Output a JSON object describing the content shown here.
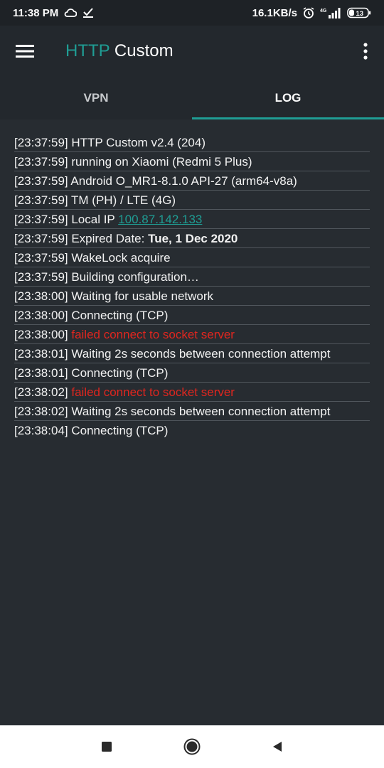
{
  "status_bar": {
    "time": "11:38 PM",
    "net_speed": "16.1KB/s",
    "battery": "13",
    "icons": [
      "cloud-icon",
      "download-check-icon",
      "alarm-icon",
      "signal-4g-icon",
      "battery-icon"
    ]
  },
  "app_bar": {
    "title_accent": "HTTP",
    "title_rest": " Custom",
    "accent_color": "#1f9d94"
  },
  "tabs": [
    {
      "label": "VPN",
      "active": false
    },
    {
      "label": "LOG",
      "active": true
    }
  ],
  "log": [
    {
      "time": "[23:37:59]",
      "parts": [
        {
          "text": " HTTP Custom v2.4 (204)",
          "style": "normal"
        }
      ]
    },
    {
      "time": "[23:37:59]",
      "parts": [
        {
          "text": " running on Xiaomi (Redmi 5 Plus)",
          "style": "normal"
        }
      ]
    },
    {
      "time": "[23:37:59]",
      "parts": [
        {
          "text": " Android O_MR1-8.1.0 API-27 (arm64-v8a)",
          "style": "normal"
        }
      ]
    },
    {
      "time": "[23:37:59]",
      "parts": [
        {
          "text": " TM (PH) / LTE (4G)",
          "style": "normal"
        }
      ]
    },
    {
      "time": "[23:37:59]",
      "parts": [
        {
          "text": " Local IP ",
          "style": "normal"
        },
        {
          "text": "100.87.142.133",
          "style": "link"
        }
      ]
    },
    {
      "time": "[23:37:59]",
      "parts": [
        {
          "text": " Expired Date: ",
          "style": "normal"
        },
        {
          "text": "Tue, 1 Dec 2020",
          "style": "bold"
        }
      ]
    },
    {
      "time": "[23:37:59]",
      "parts": [
        {
          "text": " WakeLock acquire",
          "style": "normal"
        }
      ]
    },
    {
      "time": "[23:37:59]",
      "parts": [
        {
          "text": " Building configuration…",
          "style": "normal"
        }
      ]
    },
    {
      "time": "[23:38:00]",
      "parts": [
        {
          "text": " Waiting for usable network",
          "style": "normal"
        }
      ]
    },
    {
      "time": "[23:38:00]",
      "parts": [
        {
          "text": " Connecting (TCP)",
          "style": "normal"
        }
      ]
    },
    {
      "time": "[23:38:00]",
      "parts": [
        {
          "text": " failed connect to socket server",
          "style": "error"
        }
      ]
    },
    {
      "time": "[23:38:01]",
      "parts": [
        {
          "text": " Waiting 2s seconds between connection attempt",
          "style": "normal"
        }
      ]
    },
    {
      "time": "[23:38:01]",
      "parts": [
        {
          "text": " Connecting (TCP)",
          "style": "normal"
        }
      ]
    },
    {
      "time": "[23:38:02]",
      "parts": [
        {
          "text": " failed connect to socket server",
          "style": "error"
        }
      ]
    },
    {
      "time": "[23:38:02]",
      "parts": [
        {
          "text": " Waiting 2s seconds between connection attempt",
          "style": "normal"
        }
      ]
    },
    {
      "time": "[23:38:04]",
      "parts": [
        {
          "text": " Connecting (TCP)",
          "style": "normal"
        }
      ]
    }
  ],
  "colors": {
    "error": "#e0261f",
    "link": "#1f9d94",
    "background": "#272c31"
  },
  "nav_bar": {
    "icons": [
      "recents-square-icon",
      "home-circle-icon",
      "back-triangle-icon"
    ]
  }
}
